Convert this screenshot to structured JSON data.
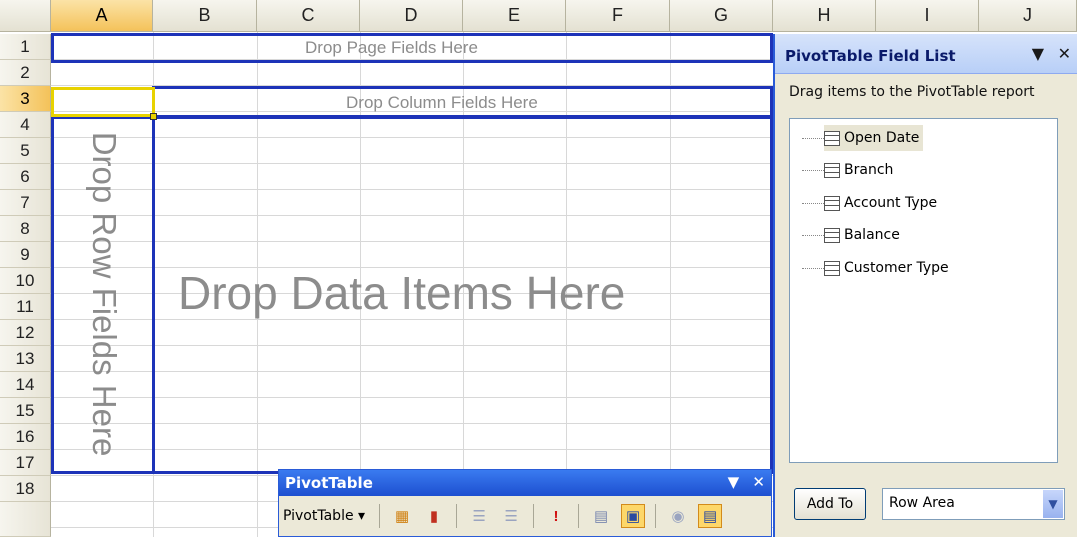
{
  "columns": [
    "A",
    "B",
    "C",
    "D",
    "E",
    "F",
    "G",
    "H",
    "I",
    "J"
  ],
  "rows": [
    "1",
    "2",
    "3",
    "4",
    "5",
    "6",
    "7",
    "8",
    "9",
    "10",
    "11",
    "12",
    "13",
    "14",
    "15",
    "16",
    "17",
    "18"
  ],
  "pivot": {
    "page_fields_placeholder": "Drop Page Fields Here",
    "column_fields_placeholder": "Drop Column Fields Here",
    "row_fields_placeholder": "Drop Row Fields Here",
    "data_items_placeholder": "Drop Data Items Here"
  },
  "field_list": {
    "title": "PivotTable Field List",
    "instruction": "Drag items to the PivotTable report",
    "fields": [
      "Open Date",
      "Branch",
      "Account Type",
      "Balance",
      "Customer Type"
    ],
    "add_button": "Add To",
    "area_value": "Row Area"
  },
  "toolbar": {
    "title": "PivotTable",
    "menu_label": "PivotTable ▾"
  },
  "colors": {
    "selection": "#f4c25a",
    "pivot_border": "#1d33b8",
    "title_bar": "#1d4fd0"
  }
}
